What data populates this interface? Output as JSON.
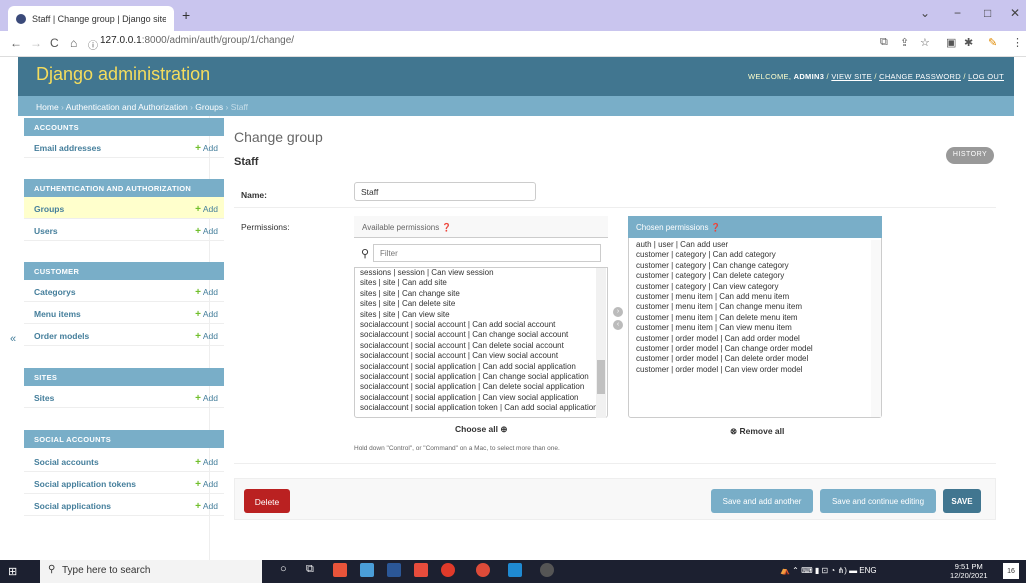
{
  "browser": {
    "tab_title": "Staff | Change group | Django site ×",
    "new_tab": "+",
    "url_host": "127.0.0.1",
    "url_rest": ":8000/admin/auth/group/1/change/",
    "win_min": "−",
    "win_max": "□",
    "win_close": "✕",
    "win_down": "⌄"
  },
  "header": {
    "branding": "Django administration",
    "welcome": "WELCOME, ",
    "user": "ADMIN3",
    "view_site": "VIEW SITE",
    "change_password": "CHANGE PASSWORD",
    "log_out": "LOG OUT",
    "sep": " / "
  },
  "breadcrumbs": {
    "home": "Home",
    "app": "Authentication and Authorization",
    "model": "Groups",
    "current": "Staff",
    "sep": " › "
  },
  "sidebar": {
    "add_label": "Add",
    "add_plus": "+",
    "collapse": "«",
    "modules": [
      {
        "caption": "ACCOUNTS",
        "items": [
          "Email addresses"
        ]
      },
      {
        "caption": "AUTHENTICATION AND AUTHORIZATION",
        "items": [
          "Groups",
          "Users"
        ]
      },
      {
        "caption": "CUSTOMER",
        "items": [
          "Categorys",
          "Menu items",
          "Order models"
        ]
      },
      {
        "caption": "SITES",
        "items": [
          "Sites"
        ]
      },
      {
        "caption": "SOCIAL ACCOUNTS",
        "items": [
          "Social accounts",
          "Social application tokens",
          "Social applications"
        ]
      }
    ]
  },
  "content": {
    "title": "Change group",
    "object": "Staff",
    "history": "HISTORY",
    "name_label": "Name:",
    "name_value": "Staff",
    "permissions_label": "Permissions:",
    "available_title": "Available permissions",
    "filter_placeholder": "Filter",
    "available": [
      "sessions | session | Can view session",
      "sites | site | Can add site",
      "sites | site | Can change site",
      "sites | site | Can delete site",
      "sites | site | Can view site",
      "socialaccount | social account | Can add social account",
      "socialaccount | social account | Can change social account",
      "socialaccount | social account | Can delete social account",
      "socialaccount | social account | Can view social account",
      "socialaccount | social application | Can add social application",
      "socialaccount | social application | Can change social application",
      "socialaccount | social application | Can delete social application",
      "socialaccount | social application | Can view social application",
      "socialaccount | social application token | Can add social application token"
    ],
    "choose_all": "Choose all",
    "chosen_title": "Chosen permissions",
    "chosen": [
      "auth | user | Can add user",
      "customer | category | Can add category",
      "customer | category | Can change category",
      "customer | category | Can delete category",
      "customer | category | Can view category",
      "customer | menu item | Can add menu item",
      "customer | menu item | Can change menu item",
      "customer | menu item | Can delete menu item",
      "customer | menu item | Can view menu item",
      "customer | order model | Can add order model",
      "customer | order model | Can change order model",
      "customer | order model | Can delete order model",
      "customer | order model | Can view order model"
    ],
    "remove_all": "Remove all",
    "help": "Hold down \"Control\", or \"Command\" on a Mac, to select more than one.",
    "delete": "Delete",
    "save_add": "Save and add another",
    "save_continue": "Save and continue editing",
    "save": "SAVE"
  },
  "taskbar": {
    "search": "Type here to search",
    "lang": "ENG",
    "time": "9:51 PM",
    "date": "12/20/2021",
    "notif": "16"
  },
  "colors": {
    "header": "#417690",
    "breadcrumbs": "#79aec8",
    "branding": "#f5dd5d",
    "delete": "#ba2121",
    "add_plus": "#70bf2b"
  }
}
